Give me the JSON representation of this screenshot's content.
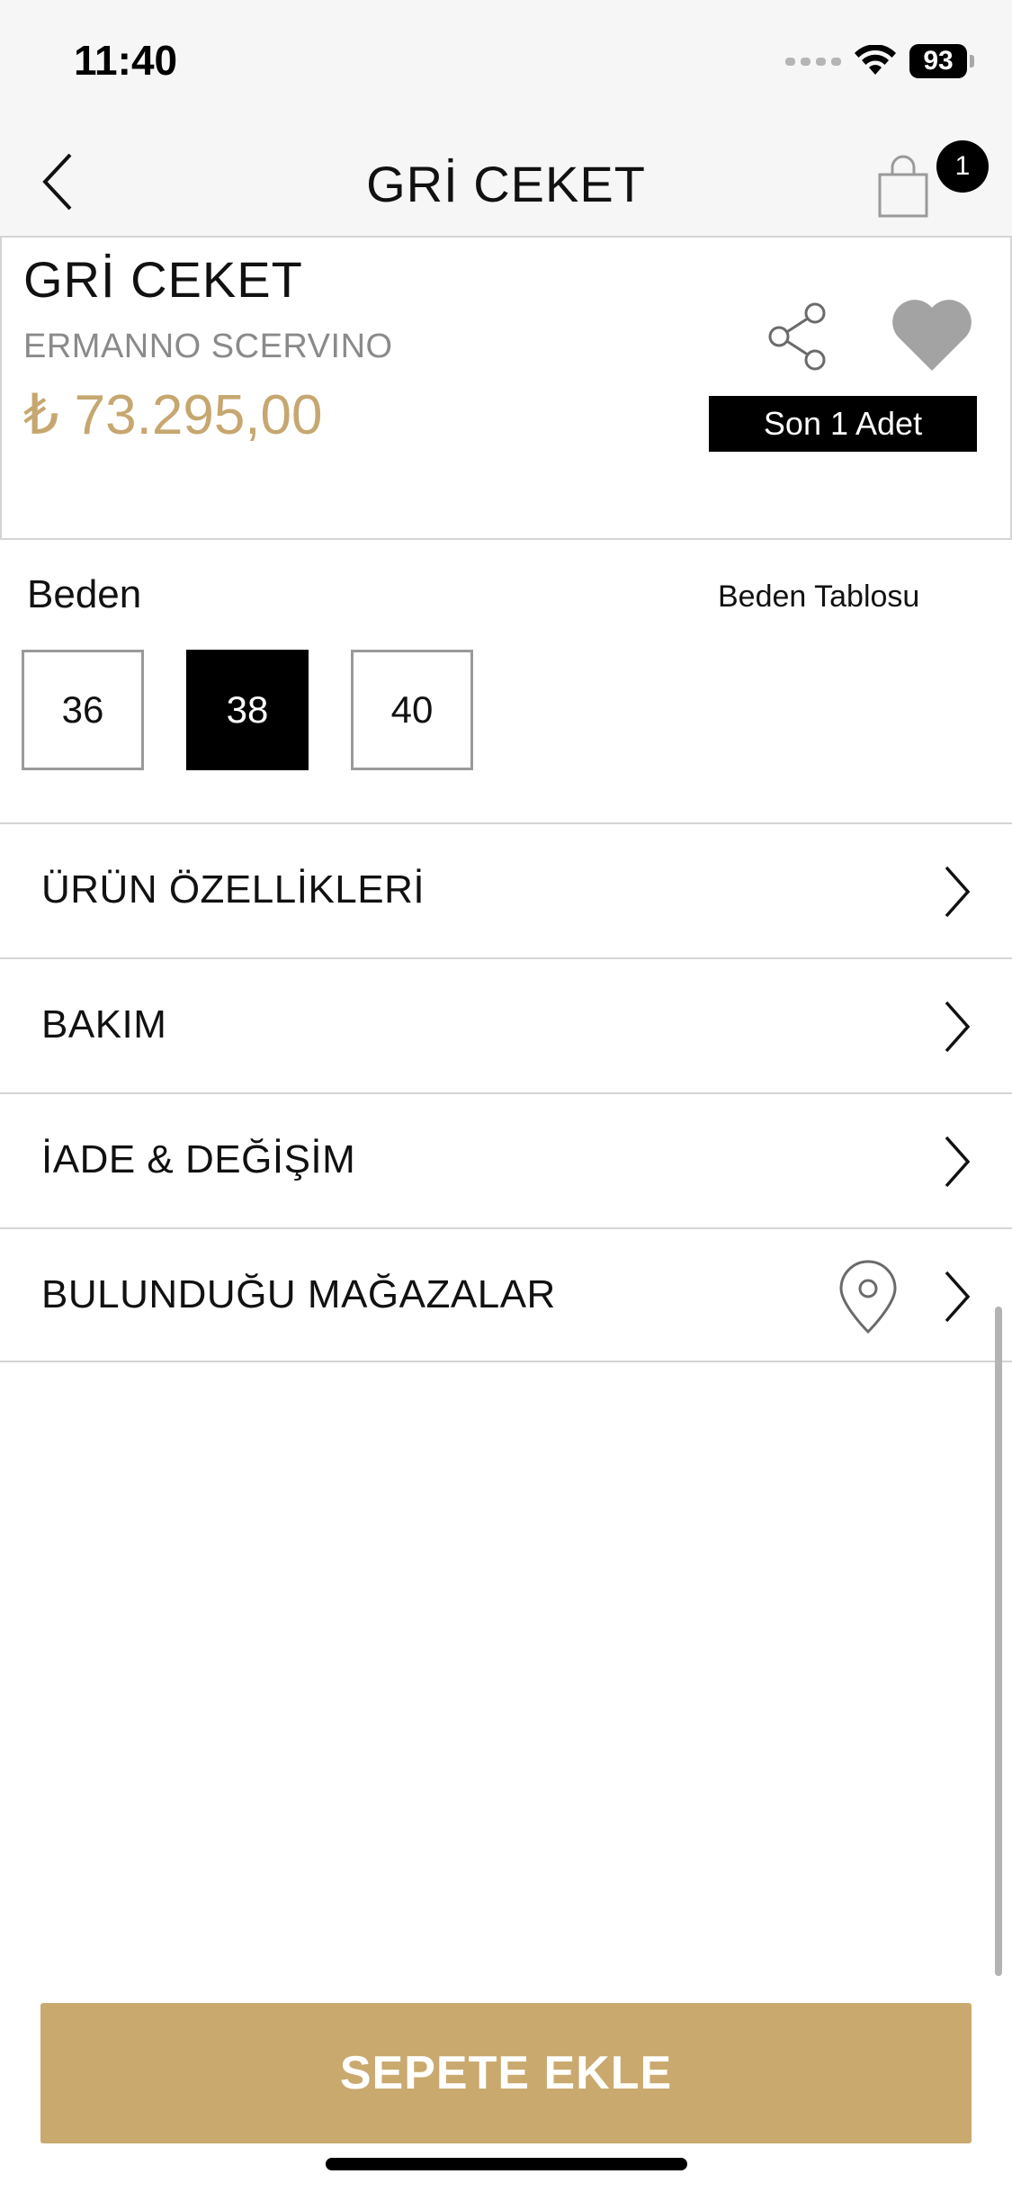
{
  "status_bar": {
    "time": "11:40",
    "battery_level": "93"
  },
  "nav": {
    "title": "GRİ CEKET",
    "cart_count": "1"
  },
  "product": {
    "name": "GRİ CEKET",
    "brand": "ERMANNO SCERVINO",
    "price": "₺ 73.295,00",
    "stock_badge": "Son 1 Adet",
    "favorite_color": "#a3a3a3",
    "price_color": "#c6a770"
  },
  "sizes": {
    "label": "Beden",
    "chart_link": "Beden Tablosu",
    "options": [
      "36",
      "38",
      "40"
    ],
    "selected": "38"
  },
  "sections": [
    {
      "label": "ÜRÜN ÖZELLİKLERİ"
    },
    {
      "label": "BAKIM"
    },
    {
      "label": "İADE & DEĞİŞİM"
    },
    {
      "label": "BULUNDUĞU MAĞAZALAR",
      "icon": "location-pin-icon"
    }
  ],
  "cta": {
    "add_to_cart": "SEPETE EKLE",
    "color": "#c9a96e"
  }
}
